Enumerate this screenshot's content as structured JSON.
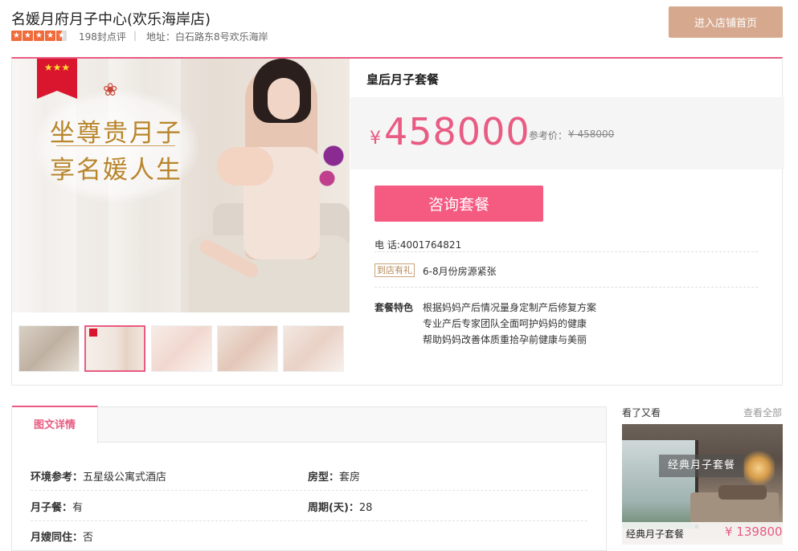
{
  "header": {
    "title": "名媛月府月子中心(欢乐海岸店)",
    "rating_stars": 4.5,
    "reviews": "198封点评",
    "separator": "|",
    "address_label": "地址：",
    "address": "白石路东8号欢乐海岸",
    "enter_store_button": "进入店铺首页"
  },
  "gallery": {
    "slogan_line1": "坐尊贵月子",
    "slogan_line2": "享名媛人生",
    "ribbon_stars": "★★★",
    "thumbnails": [
      "hotel-room",
      "promo-banner",
      "nursery",
      "mother-baby",
      "baby-care"
    ],
    "selected_thumbnail": 1
  },
  "package": {
    "name": "皇后月子套餐",
    "currency": "¥",
    "price": "458000",
    "ref_price_label": "参考价：",
    "ref_price": "¥ 458000",
    "consult_button": "咨询套餐",
    "phone": "电 话:4001764821",
    "gift_tag": "到店有礼",
    "gift_text": "6-8月份房源紧张",
    "features_label": "套餐特色",
    "features": [
      "根据妈妈产后情况量身定制产后修复方案",
      "专业产后专家团队全面呵护妈妈的健康",
      "帮助妈妈改善体质重拾孕前健康与美丽"
    ]
  },
  "details": {
    "tab_label": "图文详情",
    "attributes": [
      {
        "label": "环境参考：",
        "value": "五星级公寓式酒店"
      },
      {
        "label": "房型：",
        "value": "套房"
      },
      {
        "label": "月子餐：",
        "value": "有"
      },
      {
        "label": "周期(天)：",
        "value": "28"
      },
      {
        "label": "月嫂同住：",
        "value": "否"
      }
    ]
  },
  "recommend": {
    "title": "看了又看",
    "view_all": "查看全部",
    "item_overlay": "经典月子套餐",
    "item_name": "经典月子套餐",
    "item_price": "¥ 139800"
  },
  "colors": {
    "accent": "#e85b82",
    "consult_button": "#f55a80",
    "enter_button": "#d6a98f",
    "star": "#f06a3a"
  }
}
